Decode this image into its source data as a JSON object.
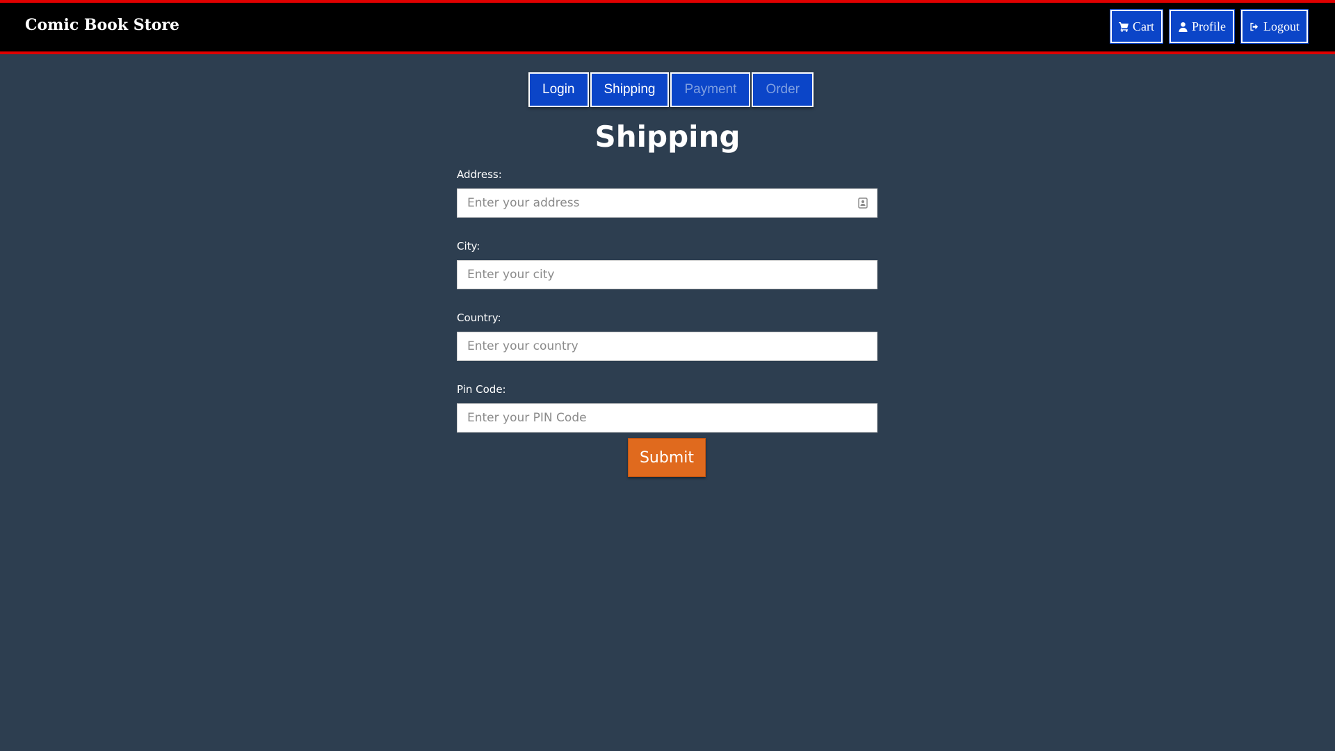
{
  "navbar": {
    "brand": "Comic Book Store",
    "buttons": [
      {
        "label": "Cart",
        "icon": "cart-icon"
      },
      {
        "label": "Profile",
        "icon": "user-icon"
      },
      {
        "label": "Logout",
        "icon": "logout-icon"
      }
    ]
  },
  "steps": [
    {
      "label": "Login",
      "enabled": true
    },
    {
      "label": "Shipping",
      "enabled": true
    },
    {
      "label": "Payment",
      "enabled": false
    },
    {
      "label": "Order",
      "enabled": false
    }
  ],
  "page": {
    "title": "Shipping"
  },
  "form": {
    "address": {
      "label": "Address:",
      "placeholder": "Enter your address",
      "value": ""
    },
    "city": {
      "label": "City:",
      "placeholder": "Enter your city",
      "value": ""
    },
    "country": {
      "label": "Country:",
      "placeholder": "Enter your country",
      "value": ""
    },
    "pin": {
      "label": "Pin Code:",
      "placeholder": "Enter your PIN Code",
      "value": ""
    },
    "submit_label": "Submit"
  },
  "colors": {
    "background": "#2d3e50",
    "navbar": "#000000",
    "navbar_border": "#e00000",
    "button_blue": "#0b45c8",
    "submit_orange": "#e06a1e"
  }
}
